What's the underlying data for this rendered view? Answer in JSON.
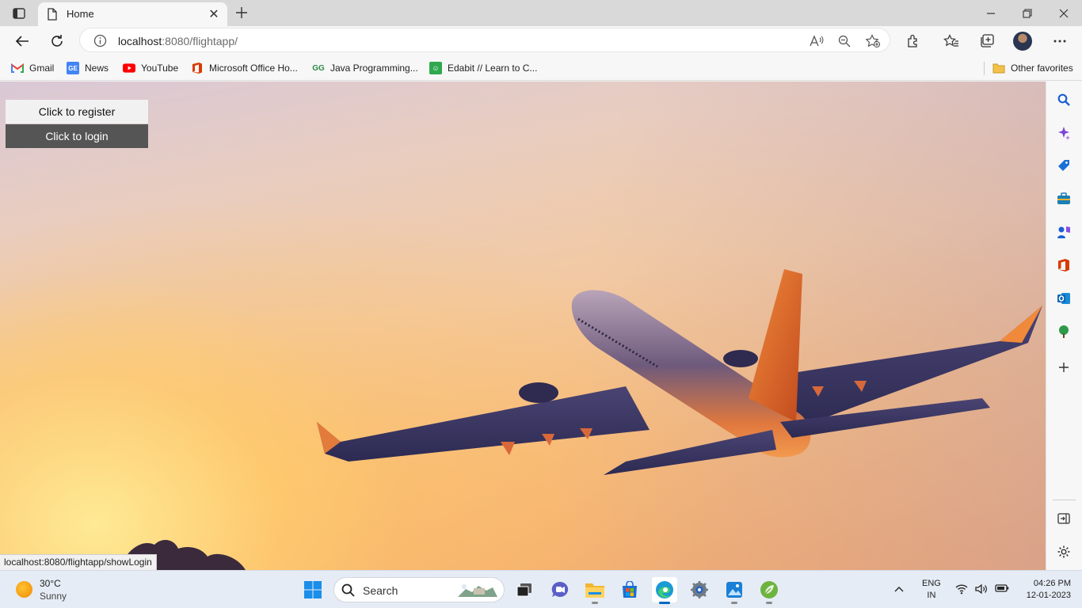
{
  "browser": {
    "tab": {
      "title": "Home"
    },
    "address_bar": {
      "host": "localhost",
      "path": ":8080/flightapp/"
    },
    "favorites": [
      {
        "label": "Gmail",
        "icon": "gmail-icon"
      },
      {
        "label": "News",
        "icon": "news-icon"
      },
      {
        "label": "YouTube",
        "icon": "youtube-icon"
      },
      {
        "label": "Microsoft Office Ho...",
        "icon": "office-icon"
      },
      {
        "label": "Java Programming...",
        "icon": "geeks-icon"
      },
      {
        "label": "Edabit // Learn to C...",
        "icon": "edabit-icon"
      }
    ],
    "other_favorites": "Other favorites",
    "status_url": "localhost:8080/flightapp/showLogin"
  },
  "page": {
    "register_label": "Click to register",
    "login_label": "Click to login"
  },
  "taskbar": {
    "weather": {
      "temp": "30°C",
      "condition": "Sunny"
    },
    "search_label": "Search",
    "lang": {
      "line1": "ENG",
      "line2": "IN"
    },
    "clock": {
      "time": "04:26 PM",
      "date": "12-01-2023"
    }
  },
  "colors": {
    "accent": "#0067c0",
    "login_button_bg": "#555555",
    "register_button_bg": "#f1f1f1"
  }
}
